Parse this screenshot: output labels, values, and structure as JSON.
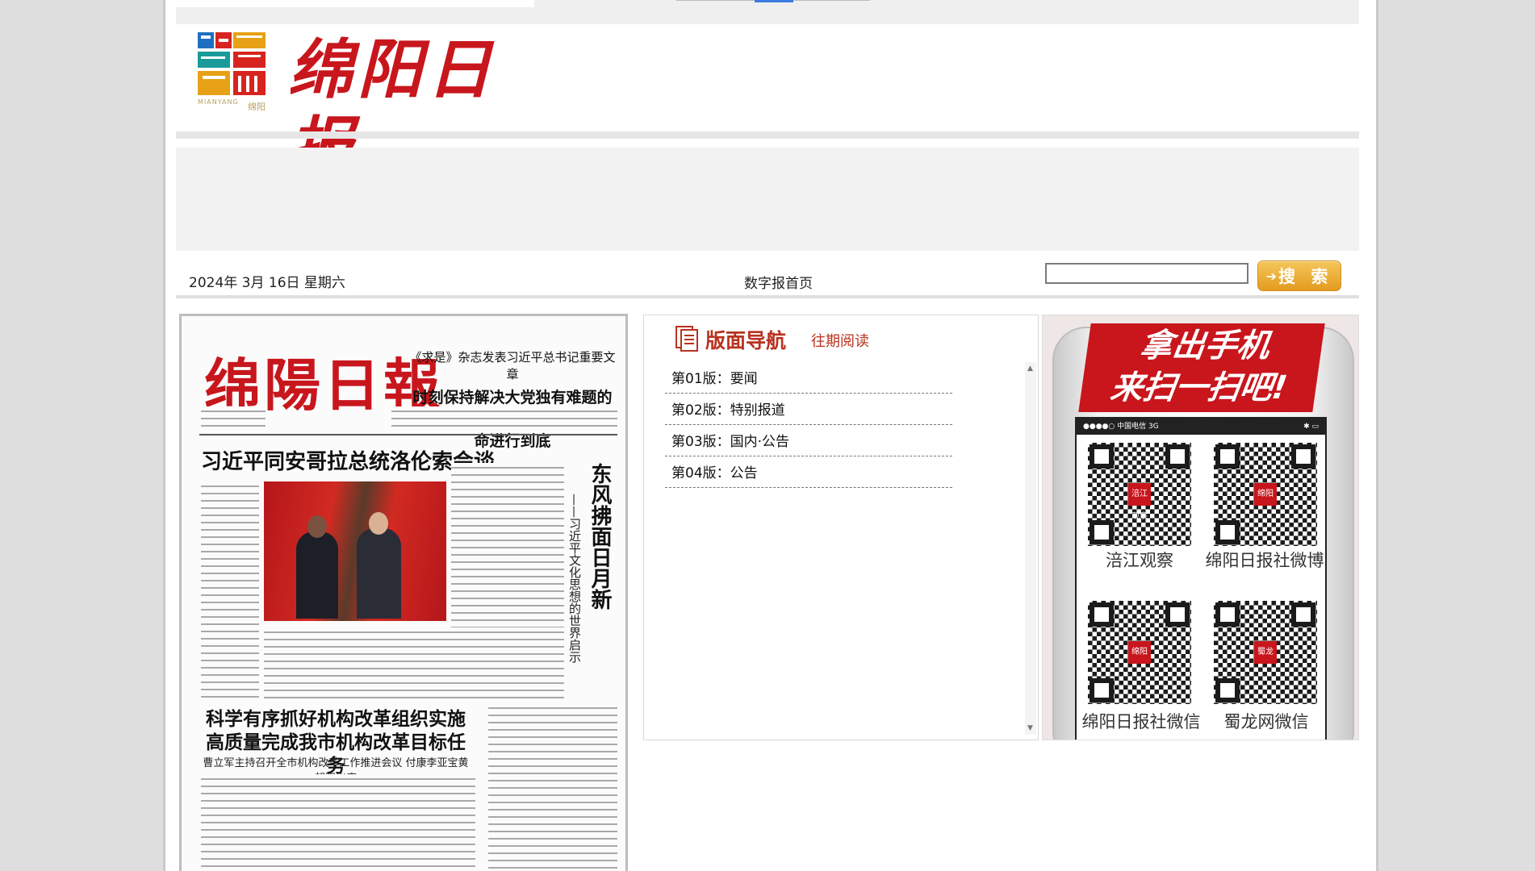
{
  "masthead": {
    "logo_name": "绵阳日报",
    "logo_sub": "MIANYANG",
    "logo_sub_cn": "绵阳",
    "logo_colors": [
      "#1f6fc1",
      "#d7241e",
      "#e7a117",
      "#1b9a9a"
    ]
  },
  "toolbar": {
    "date": "2024年 3月 16日 星期六",
    "home_link": "数字报首页",
    "search_placeholder": "",
    "search_button": "搜 索"
  },
  "paper_preview": {
    "masthead": "绵陽日報",
    "top_kicker": "《求是》杂志发表习近平总书记重要文章",
    "top_headline": "时刻保持解决大党独有难题的清醒和坚定 把党的伟大自我革命进行到底",
    "headline_1": "习近平同安哥拉总统洛伦索会谈",
    "vertical_headline": "东风拂面日月新",
    "vertical_sub": "——习近平文化思想的世界启示",
    "headline_2": "科学有序抓好机构改革组织实施 高质量完成我市机构改革目标任务",
    "headline_2_sub": "曹立军主持召开全市机构改革工作推进会议 付康李亚宝黄朝阳出席"
  },
  "nav_panel": {
    "title": "版面导航",
    "past_link": "往期阅读",
    "items": [
      {
        "label": "第01版：要闻"
      },
      {
        "label": "第02版：特别报道"
      },
      {
        "label": "第03版：国内·公告"
      },
      {
        "label": "第04版：公告"
      }
    ]
  },
  "promo": {
    "slogan_line1": "拿出手机",
    "slogan_line2": "来扫一扫吧!",
    "status_left": "●●●●○ 中国电信  3G",
    "status_right": "✱ ▭",
    "qr_codes": [
      {
        "label": "涪江观察",
        "badge": "涪江观察"
      },
      {
        "label": "绵阳日报社微博",
        "badge": "绵阳"
      },
      {
        "label": "绵阳日报社微信",
        "badge": "绵阳"
      },
      {
        "label": "蜀龙网微信",
        "badge": "蜀龙"
      }
    ],
    "accent_color": "#c9151c"
  }
}
